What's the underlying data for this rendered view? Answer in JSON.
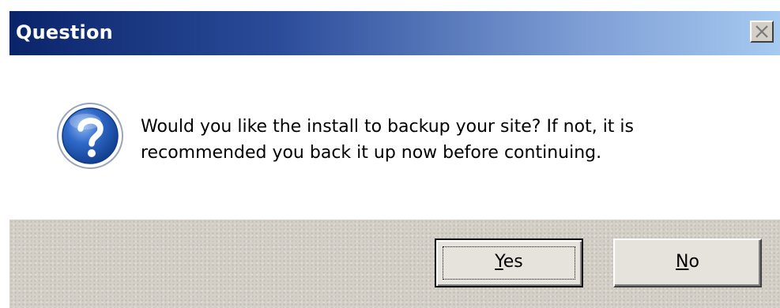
{
  "window": {
    "title": "Question",
    "close_icon": "close-x-icon"
  },
  "content": {
    "icon": "question-mark-icon",
    "message_line1": "Would you like the install to backup your site? If not, it is",
    "message_line2": "recommended you back it up now before continuing."
  },
  "buttons": {
    "yes": {
      "accel": "Y",
      "rest": "es"
    },
    "no": {
      "accel": "N",
      "rest": "o"
    }
  },
  "colors": {
    "titlebar_start": "#0a246a",
    "titlebar_end": "#a6caf0",
    "face": "#d4d0c8",
    "icon_blue": "#1f56b8"
  }
}
